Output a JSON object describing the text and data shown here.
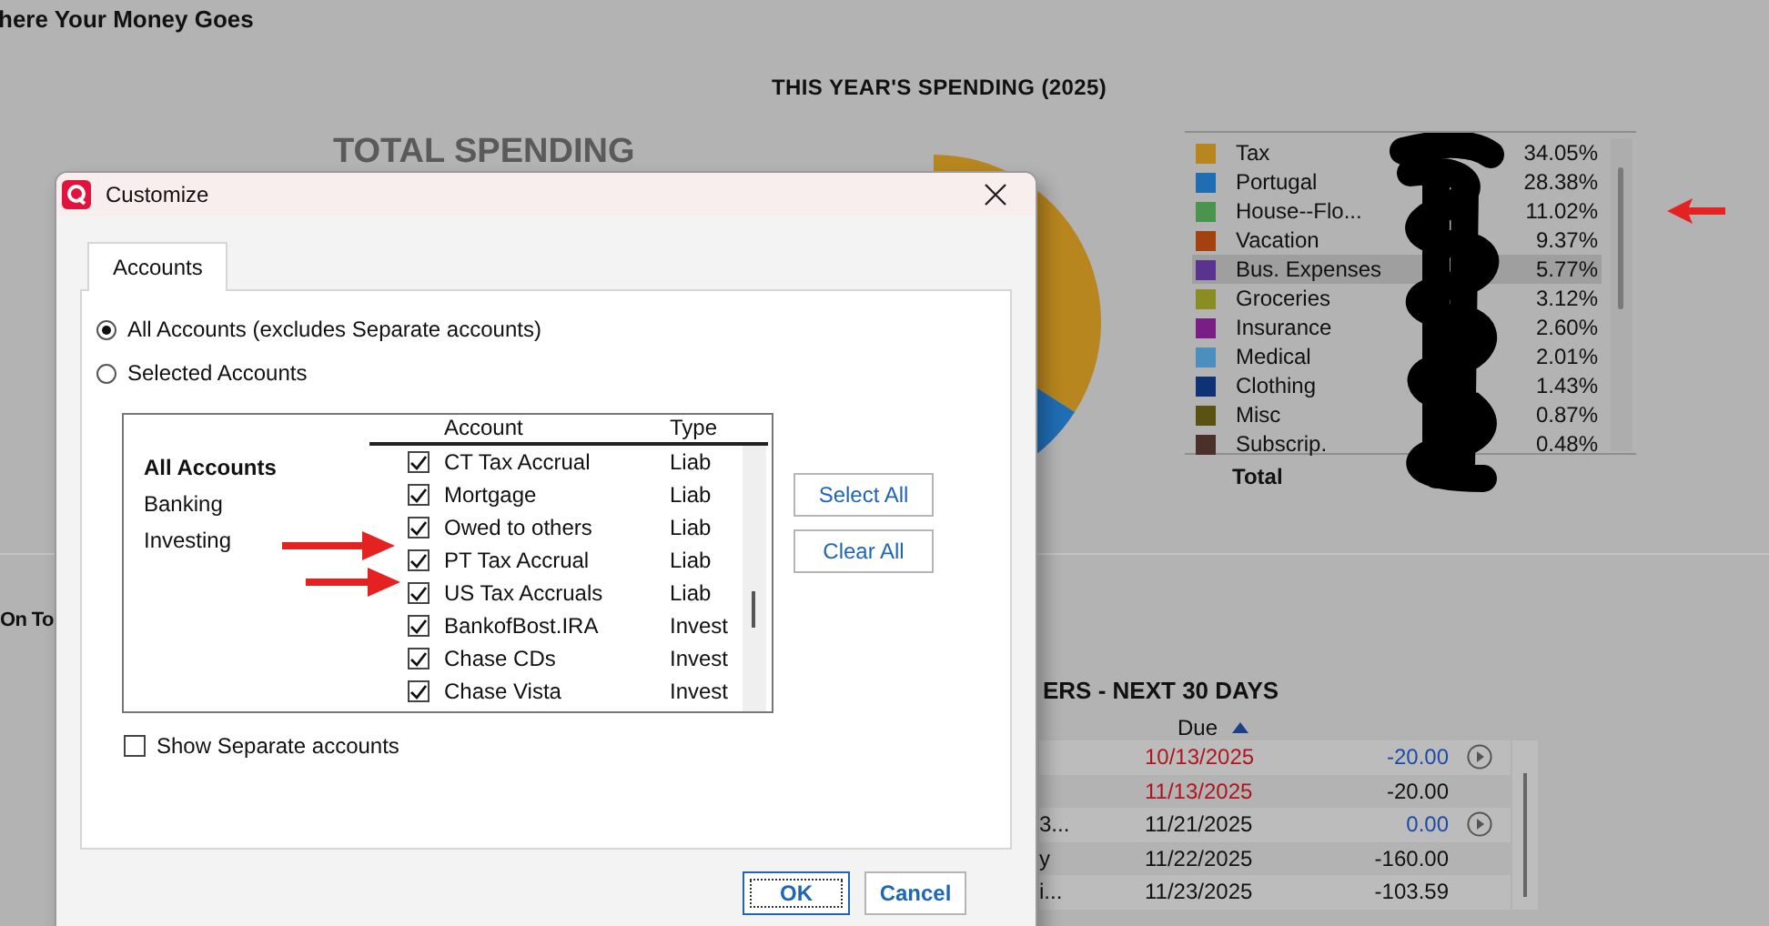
{
  "background": {
    "page_title": "here Your Money Goes",
    "chart_heading": "THIS YEAR'S SPENDING (2025)",
    "total_heading": "TOTAL SPENDING",
    "legend": [
      {
        "label": "Tax",
        "color": "#b8861f",
        "percent": "34.05%",
        "selected": false
      },
      {
        "label": "Portugal",
        "color": "#1f6db3",
        "percent": "28.38%",
        "selected": false
      },
      {
        "label": "House--Flo...",
        "color": "#4a9450",
        "percent": "11.02%",
        "selected": false
      },
      {
        "label": "Vacation",
        "color": "#a4420f",
        "percent": "9.37%",
        "selected": false
      },
      {
        "label": "Bus. Expenses",
        "color": "#5a3290",
        "percent": "5.77%",
        "selected": true
      },
      {
        "label": "Groceries",
        "color": "#8a8e22",
        "percent": "3.12%",
        "selected": false
      },
      {
        "label": "Insurance",
        "color": "#781e84",
        "percent": "2.60%",
        "selected": false
      },
      {
        "label": "Medical",
        "color": "#4a8fbe",
        "percent": "2.01%",
        "selected": false
      },
      {
        "label": "Clothing",
        "color": "#0f3275",
        "percent": "1.43%",
        "selected": false
      },
      {
        "label": "Misc",
        "color": "#5a5212",
        "percent": "0.87%",
        "selected": false
      },
      {
        "label": "Subscrip.",
        "color": "#4a3029",
        "percent": "0.48%",
        "selected": false
      }
    ],
    "legend_total_label": "Total",
    "section_label": "On To",
    "bills_heading": "ERS - NEXT 30 DAYS",
    "due_header": {
      "label": "Due",
      "sorted_ascending": true
    },
    "bills": [
      {
        "due": "10/13/2025",
        "overdue": true,
        "amount": {
          "text": "-20.00",
          "color": "#1d4aa8"
        },
        "action": true
      },
      {
        "due": "11/13/2025",
        "overdue": true,
        "amount": {
          "text": "-20.00",
          "color": "#111111"
        },
        "action": false
      },
      {
        "name": "3...",
        "due": "11/21/2025",
        "overdue": false,
        "amount": {
          "text": "0.00",
          "color": "#1d4aa8"
        },
        "action": true
      },
      {
        "name": "y",
        "due": "11/22/2025",
        "overdue": false,
        "amount": {
          "text": "-160.00",
          "color": "#111111"
        },
        "action": false
      },
      {
        "name": "i...",
        "due": "11/23/2025",
        "overdue": false,
        "amount": {
          "text": "-103.59",
          "color": "#111111"
        },
        "action": false
      }
    ]
  },
  "dialog": {
    "title": "Customize",
    "tabs": [
      {
        "label": "Accounts",
        "selected": true
      }
    ],
    "scope_options": [
      {
        "label": "All Accounts (excludes Separate accounts)",
        "selected": true
      },
      {
        "label": "Selected Accounts",
        "selected": false
      }
    ],
    "groups": [
      {
        "label": "All Accounts",
        "selected": true
      },
      {
        "label": "Banking",
        "selected": false
      },
      {
        "label": "Investing",
        "selected": false
      }
    ],
    "columns": [
      "Account",
      "Type"
    ],
    "accounts": [
      {
        "name": "CT Tax Accrual",
        "type": "Liab",
        "checked": true
      },
      {
        "name": "Mortgage",
        "type": "Liab",
        "checked": true
      },
      {
        "name": "Owed to others",
        "type": "Liab",
        "checked": true
      },
      {
        "name": "PT Tax Accrual",
        "type": "Liab",
        "checked": true
      },
      {
        "name": "US Tax Accruals",
        "type": "Liab",
        "checked": true
      },
      {
        "name": "BankofBost.IRA",
        "type": "Invest",
        "checked": true
      },
      {
        "name": "Chase CDs",
        "type": "Invest",
        "checked": true
      },
      {
        "name": "Chase Vista",
        "type": "Invest",
        "checked": true
      }
    ],
    "side_buttons": [
      "Select All",
      "Clear All"
    ],
    "show_separate": {
      "label": "Show Separate accounts",
      "checked": false
    },
    "buttons": [
      {
        "label": "OK",
        "default": true
      },
      {
        "label": "Cancel",
        "default": false
      }
    ]
  }
}
